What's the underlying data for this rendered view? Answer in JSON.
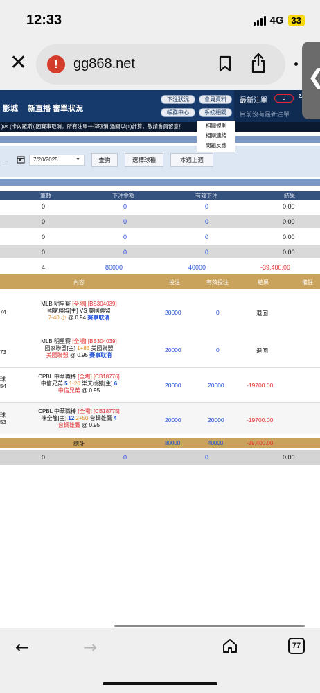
{
  "status": {
    "time": "12:33",
    "network": "4G",
    "battery": "33"
  },
  "browser": {
    "url": "gg868.net",
    "tab_count": "77",
    "side_tab_glyph": "❮"
  },
  "header": {
    "nav_a": "影城",
    "nav_b": "新直播 審單狀況",
    "btn_bet_status": "下注狀況",
    "btn_member_info": "會員資料",
    "btn_account_center": "帳務中心",
    "btn_system": "系統相關",
    "latest_title": "最新注單",
    "latest_count": "0",
    "latest_empty": "目前沒有最新注單"
  },
  "dropdown": {
    "items": [
      "相關規則",
      "相關連結",
      "問題反應"
    ]
  },
  "marquee": ")vs.(卡內羅斯))因賽事取消，所有注單一律取消,過關以(1)計算，敬請會員留意！",
  "filter": {
    "dash": "~",
    "date": "7/20/2025",
    "query": "查詢",
    "select_sport": "選擇球種",
    "this_week_prev": "本週上週"
  },
  "summary": {
    "headers": [
      "筆數",
      "下注金額",
      "有效下注",
      "結果"
    ],
    "rows": [
      [
        "0",
        "0",
        "0",
        "0.00"
      ],
      [
        "0",
        "0",
        "0",
        "0.00"
      ],
      [
        "0",
        "0",
        "0",
        "0.00"
      ],
      [
        "0",
        "0",
        "0",
        "0.00"
      ],
      [
        "4",
        "80000",
        "40000",
        "-39,400.00"
      ]
    ]
  },
  "detail": {
    "headers": [
      "內容",
      "投注",
      "有效投注",
      "結果",
      "備註"
    ],
    "rows": [
      {
        "side1": "74",
        "side2": "",
        "line1_a": "MLB 明星賽 ",
        "line1_b": "[全場] [BS304039]",
        "line2_a": "國家聯盟[主] VS 美國聯盟",
        "line2_b": "",
        "line2_c": "",
        "line2_d": "",
        "line2_e": "",
        "line3_a": "7-40 小",
        "line3_b": " @ 0.94 ",
        "line3_c": "賽事取消",
        "bet": "20000",
        "valid": "0",
        "result": "退回"
      },
      {
        "side1": "73",
        "side2": "",
        "line1_a": "MLB 明星賽 ",
        "line1_b": "[全場] [BS304039]",
        "line2_a": "國家聯盟[主] ",
        "line2_b": "1+85",
        "line2_c": " 美國聯盟",
        "line2_d": "",
        "line2_e": "",
        "line3_a": "美國聯盟",
        "line3_b": " @ 0.95 ",
        "line3_c": "賽事取消",
        "bet": "20000",
        "valid": "0",
        "result": "退回"
      },
      {
        "side1": "球",
        "side2": "54",
        "line1_a": "CPBL 中華職棒 ",
        "line1_b": "[全場] [CB18776]",
        "line2_a": "中信兄弟 ",
        "line2_b": "5",
        "line2_c": " 1-20 ",
        "line2_d": "樂天桃猿[主] ",
        "line2_e": "6",
        "line3_a": "中信兄弟",
        "line3_b": " @ 0.95",
        "line3_c": "",
        "bet": "20000",
        "valid": "20000",
        "result": "-19700.00"
      },
      {
        "side1": "球",
        "side2": "53",
        "line1_a": "CPBL 中華職棒 ",
        "line1_b": "[全場] [CB18775]",
        "line2_a": "味全龍[主] ",
        "line2_b": "12",
        "line2_c": " 2+50 ",
        "line2_d": "台鋼雄鷹 ",
        "line2_e": "4",
        "line3_a": "台鋼雄鷹",
        "line3_b": " @ 0.95",
        "line3_c": "",
        "bet": "20000",
        "valid": "20000",
        "result": "-19700.00"
      }
    ],
    "total_label": "總計",
    "total_bet": "80000",
    "total_valid": "40000",
    "total_result": "-39,400.00"
  },
  "bottom_sum": [
    "0",
    "0",
    "0",
    "0.00"
  ],
  "colors": {
    "header": "#163a6b",
    "gold": "#c9a25c",
    "blue": "#1f4fd9",
    "red": "#e23030"
  }
}
